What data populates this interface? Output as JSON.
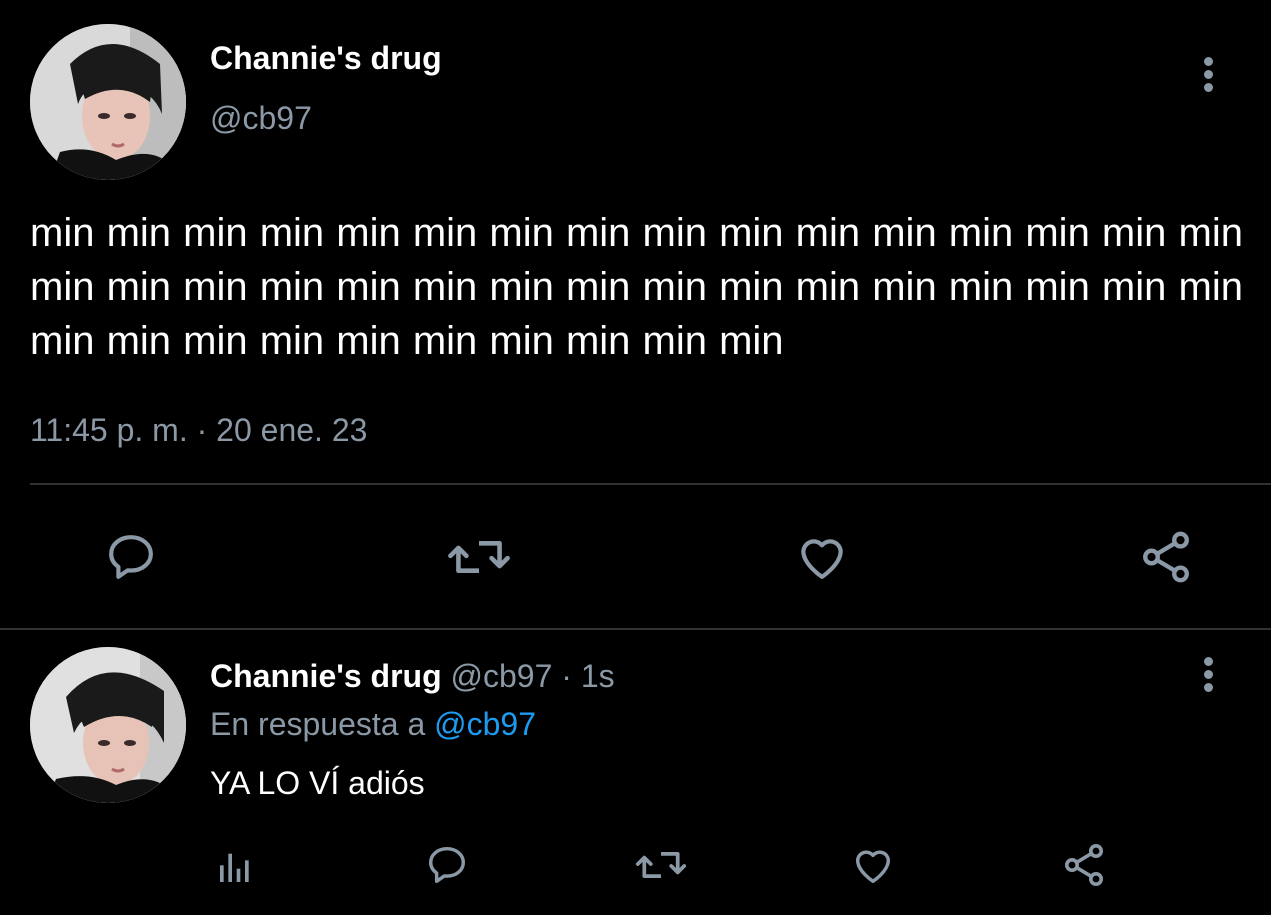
{
  "main_tweet": {
    "display_name": "Channie's drug",
    "handle": "@cb97",
    "text": "min min min min min min min min min min min min min min min min min min min min min min min min min min min min min min min min min min min min min min min min min min",
    "timestamp": "11:45 p. m. · 20 ene. 23",
    "actions": {
      "reply": "speech-bubble-icon",
      "retweet": "retweet-icon",
      "like": "heart-icon",
      "share": "share-icon"
    }
  },
  "reply_tweet": {
    "display_name": "Channie's drug",
    "handle": "@cb97",
    "time_ago": "1s",
    "reply_prefix": "En respuesta a",
    "reply_to": "@cb97",
    "text": "YA LO VÍ adiós",
    "actions": {
      "analytics": "bar-chart-icon",
      "reply": "speech-bubble-icon",
      "retweet": "retweet-icon",
      "like": "heart-icon",
      "share": "share-icon"
    }
  },
  "colors": {
    "background": "#000000",
    "text": "#ffffff",
    "muted": "#8b98a5",
    "link": "#1d9bf0",
    "divider": "#2f3336"
  }
}
